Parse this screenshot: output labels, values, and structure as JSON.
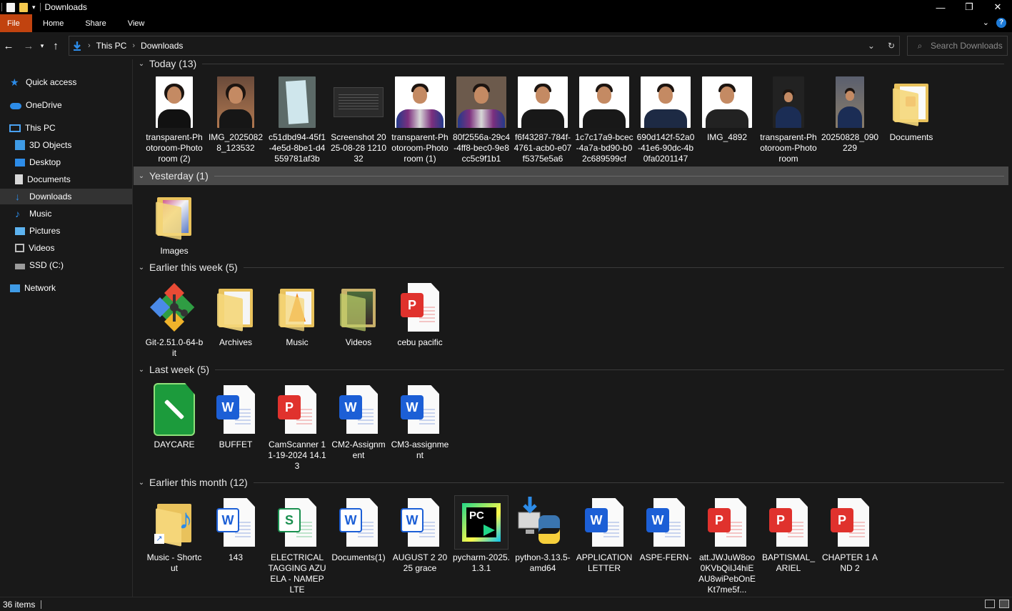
{
  "window": {
    "title": "Downloads"
  },
  "ribbon": {
    "tabs": [
      "File",
      "Home",
      "Share",
      "View"
    ]
  },
  "address": {
    "crumbs": [
      "This PC",
      "Downloads"
    ]
  },
  "search": {
    "placeholder": "Search Downloads"
  },
  "sidebar": {
    "items": [
      {
        "label": "Quick access",
        "icon": "star-icon"
      },
      {
        "label": "OneDrive",
        "icon": "cloud-icon"
      },
      {
        "label": "This PC",
        "icon": "pc-icon"
      },
      {
        "label": "3D Objects",
        "icon": "cube-icon"
      },
      {
        "label": "Desktop",
        "icon": "desktop-icon"
      },
      {
        "label": "Documents",
        "icon": "document-icon"
      },
      {
        "label": "Downloads",
        "icon": "download-icon"
      },
      {
        "label": "Music",
        "icon": "music-icon"
      },
      {
        "label": "Pictures",
        "icon": "pictures-icon"
      },
      {
        "label": "Videos",
        "icon": "videos-icon"
      },
      {
        "label": "SSD (C:)",
        "icon": "drive-icon"
      },
      {
        "label": "Network",
        "icon": "network-icon"
      }
    ]
  },
  "groups": {
    "today": {
      "header": "Today (13)",
      "items": [
        "transparent-Photoroom-Photoroom (2)",
        "IMG_20250828_123532",
        "c51dbd94-45f1-4e5d-8be1-d4559781af3b",
        "Screenshot 2025-08-28 121032",
        "transparent-Photoroom-Photoroom (1)",
        "80f2556a-29c4-4ff8-bec0-9e8cc5c9f1b1",
        "f6f43287-784f-4761-acb0-e07f5375e5a6",
        "1c7c17a9-bcec-4a7a-bd90-b02c689599cf",
        "690d142f-52a0-41e6-90dc-4b0fa0201147",
        "IMG_4892",
        "transparent-Photoroom-Photoroom",
        "20250828_090229",
        "Documents"
      ]
    },
    "yesterday": {
      "header": "Yesterday (1)",
      "items": [
        "Images"
      ]
    },
    "earlier_week": {
      "header": "Earlier this week (5)",
      "items": [
        "Git-2.51.0-64-bit",
        "Archives",
        "Music",
        "Videos",
        "cebu pacific"
      ]
    },
    "last_week": {
      "header": "Last week (5)",
      "items": [
        "DAYCARE",
        "BUFFET",
        "CamScanner 11-19-2024 14.13",
        "CM2-Assignment",
        "CM3-assignment"
      ]
    },
    "earlier_month": {
      "header": "Earlier this month (12)",
      "items": [
        "Music - Shortcut",
        "143",
        "ELECTRICAL TAGGING AZUELA - NAMEPLTE",
        "Documents(1)",
        "AUGUST 2 2025 grace",
        "pycharm-2025.1.3.1",
        "python-3.13.5-amd64",
        "APPLICATION LETTER",
        "ASPE-FERN-",
        "att.JWJuW8oo0KVbQiIJ4hiEAU8wiPebOnEKt7me5f...",
        "BAPTISMAL_ARIEL",
        "CHAPTER 1 AND 2"
      ]
    }
  },
  "status": {
    "count": "36 items"
  },
  "colors": {
    "file_tab": "#c1430f",
    "accent": "#1e7bd7",
    "background": "#191919"
  }
}
